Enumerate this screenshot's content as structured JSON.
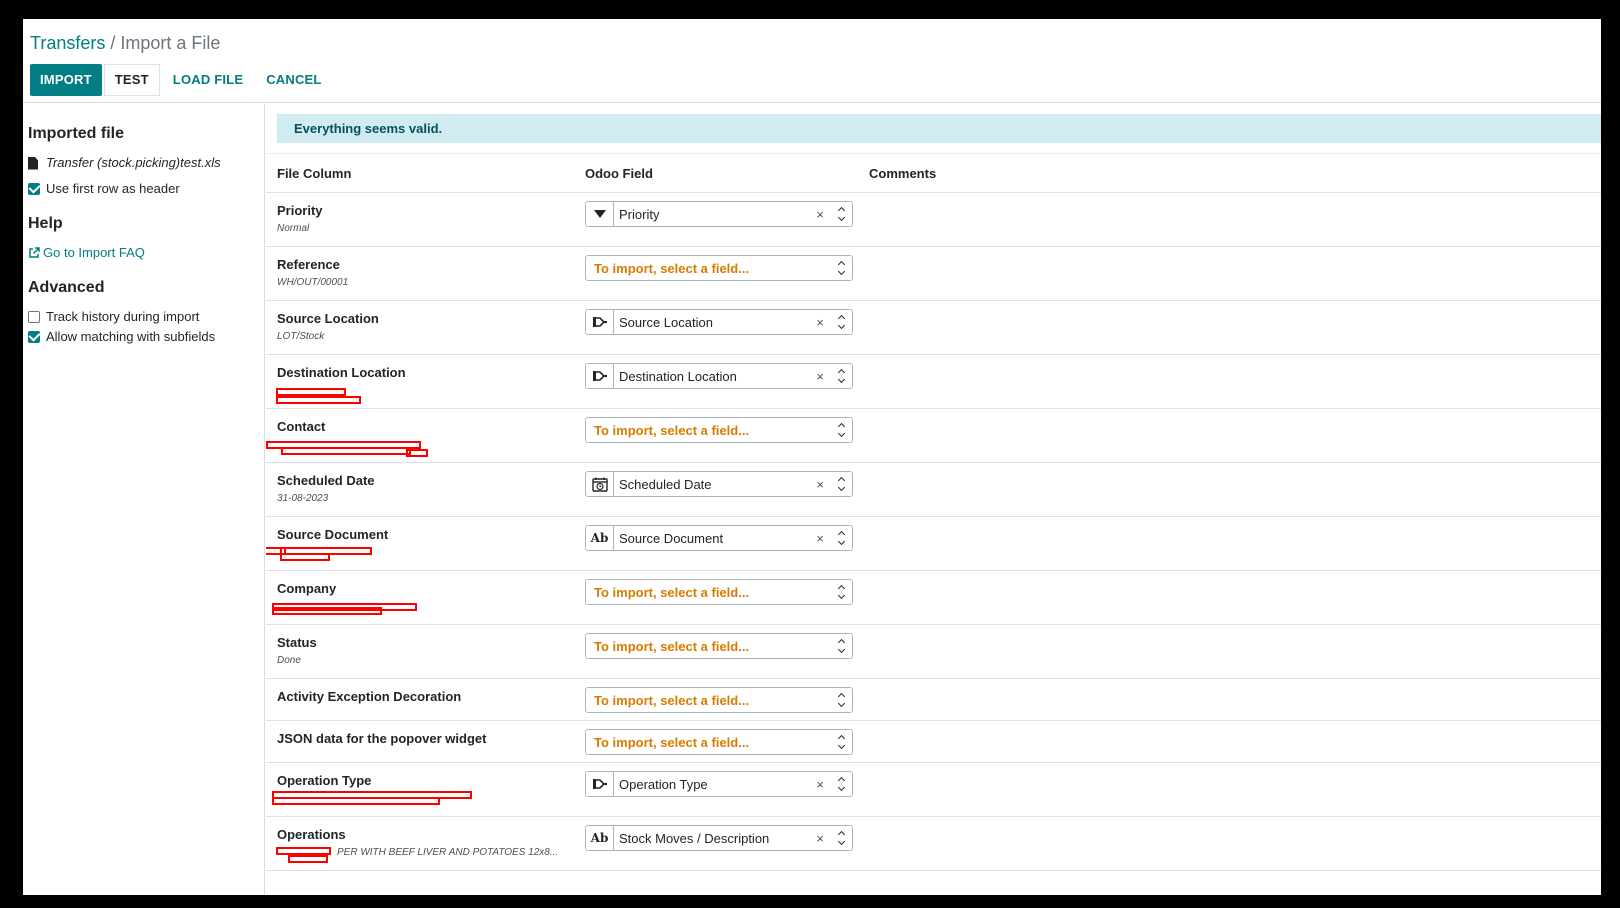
{
  "breadcrumb": {
    "parent": "Transfers",
    "separator": "/",
    "current": "Import a File"
  },
  "buttons": {
    "import": "IMPORT",
    "test": "TEST",
    "load_file": "LOAD FILE",
    "cancel": "CANCEL"
  },
  "sidebar": {
    "imported_heading": "Imported file",
    "file_name": "Transfer (stock.picking)test.xls",
    "use_header_label": "Use first row as header",
    "use_header_checked": true,
    "help_heading": "Help",
    "faq_link": "Go to Import FAQ",
    "advanced_heading": "Advanced",
    "track_history_label": "Track history during import",
    "track_history_checked": false,
    "allow_matching_label": "Allow matching with subfields",
    "allow_matching_checked": true
  },
  "alert": "Everything seems valid.",
  "table": {
    "headers": {
      "file_column": "File Column",
      "odoo_field": "Odoo Field",
      "comments": "Comments"
    },
    "rows": [
      {
        "name": "Priority",
        "value": "Normal",
        "field": "Priority",
        "icon": "dropdown-icon"
      },
      {
        "name": "Reference",
        "value": "WH/OUT/00001",
        "field": "",
        "icon": ""
      },
      {
        "name": "Source Location",
        "value": "LOT/Stock",
        "field": "Source Location",
        "icon": "many2one-icon"
      },
      {
        "name": "Destination Location",
        "value": "",
        "field": "Destination Location",
        "icon": "many2one-icon"
      },
      {
        "name": "Contact",
        "value": "",
        "field": "",
        "icon": ""
      },
      {
        "name": "Scheduled Date",
        "value": "31-08-2023",
        "field": "Scheduled Date",
        "icon": "calendar-icon"
      },
      {
        "name": "Source Document",
        "value": "",
        "field": "Source Document",
        "icon": "text-icon"
      },
      {
        "name": "Company",
        "value": "",
        "field": "",
        "icon": ""
      },
      {
        "name": "Status",
        "value": "Done",
        "field": "",
        "icon": ""
      },
      {
        "name": "Activity Exception Decoration",
        "value": "",
        "field": "",
        "icon": ""
      },
      {
        "name": "JSON data for the popover widget",
        "value": "",
        "field": "",
        "icon": ""
      },
      {
        "name": "Operation Type",
        "value": "",
        "field": "Operation Type",
        "icon": "many2one-icon"
      },
      {
        "name": "Operations",
        "value": "PER WITH BEEF LIVER AND POTATOES 12x8...",
        "field": "Stock Moves / Description",
        "icon": "text-icon"
      }
    ],
    "placeholder": "To import, select a field...",
    "text_icon_label": "Ab"
  }
}
